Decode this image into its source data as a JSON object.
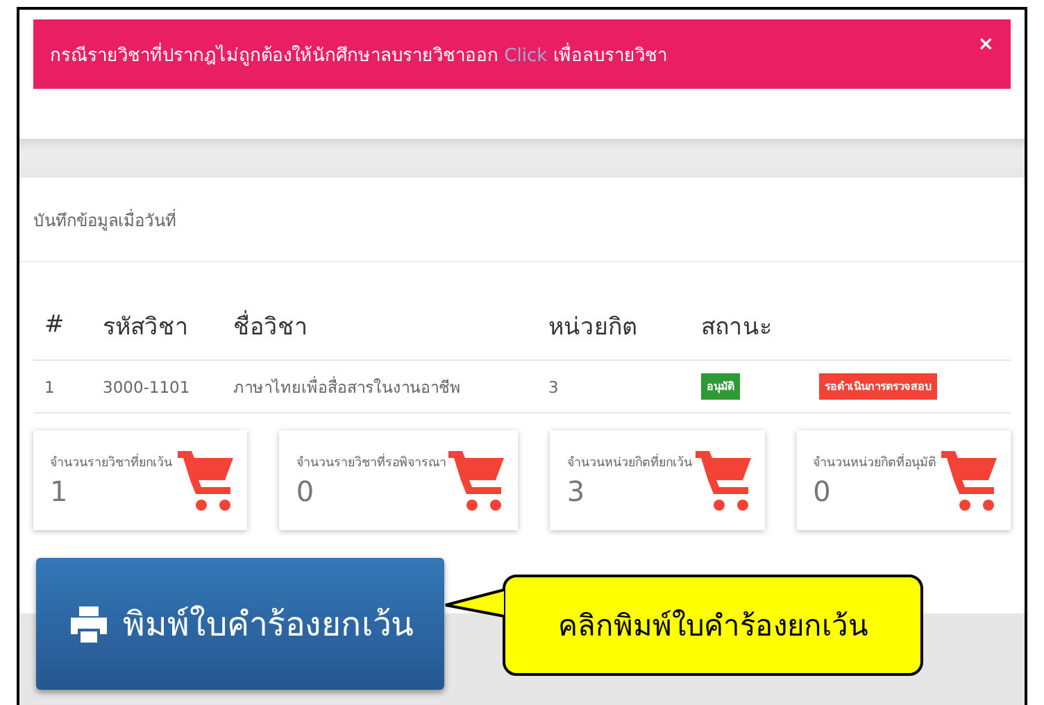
{
  "alert": {
    "text": "กรณีรายวิชาที่ปรากฎไม่ถูกต้องให้นักศึกษาลบรายวิชาออก",
    "link": "Click",
    "text_after": "เพื่อลบรายวิชา",
    "close": "×"
  },
  "record_label": "บันทึกข้อมูลเมื่อวันที่",
  "table": {
    "columns": [
      "#",
      "รหัสวิชา",
      "ชื่อวิชา",
      "หน่วยกิต",
      "สถานะ"
    ],
    "rows": [
      {
        "cells": [
          "1",
          "3000-1101",
          "ภาษาไทยเพื่อสื่อสารในงานอาชีพ",
          "3"
        ],
        "badges": [
          {
            "text": "อนุมัติ",
            "color": "#2e9a36"
          },
          {
            "text": "รอดำเนินการตรวจสอบ",
            "color": "#f44336"
          }
        ]
      }
    ]
  },
  "cards": [
    {
      "label": "จำนวนรายวิชาที่ยกเว้น",
      "value": "1"
    },
    {
      "label": "จำนวนรายวิชาที่รอพิจารณา",
      "value": "0"
    },
    {
      "label": "จำนวนหน่วยกิตที่ยกเว้น",
      "value": "3"
    },
    {
      "label": "จำนวนหน่วยกิตที่อนุมัติ",
      "value": "0"
    }
  ],
  "print_button": "พิมพ์ใบคำร้องยกเว้น",
  "callout": "คลิกพิมพ์ใบคำร้องยกเว้น"
}
